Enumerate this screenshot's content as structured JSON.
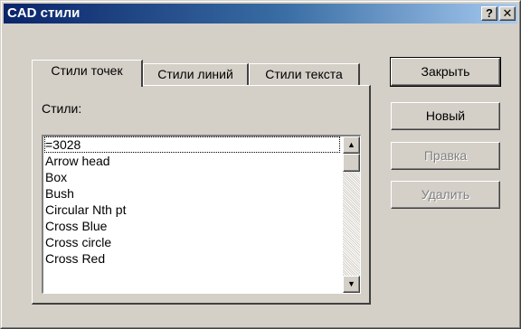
{
  "window": {
    "title": "CAD стили"
  },
  "titlebar_buttons": {
    "help": "?",
    "close": "✕"
  },
  "tabs": [
    {
      "label": "Стили точек",
      "active": true
    },
    {
      "label": "Стили линий",
      "active": false
    },
    {
      "label": "Стили текста",
      "active": false
    }
  ],
  "panel": {
    "styles_label": "Стили:"
  },
  "list": {
    "items": [
      "=3028",
      "Arrow head",
      "Box",
      "Bush",
      "Circular Nth pt",
      "Cross Blue",
      "Cross circle",
      "Cross Red"
    ],
    "selected": "=3028"
  },
  "scrollbar": {
    "up": "▲",
    "down": "▼"
  },
  "buttons": {
    "close": "Закрыть",
    "new": "Новый",
    "edit": "Правка",
    "delete": "Удалить"
  }
}
